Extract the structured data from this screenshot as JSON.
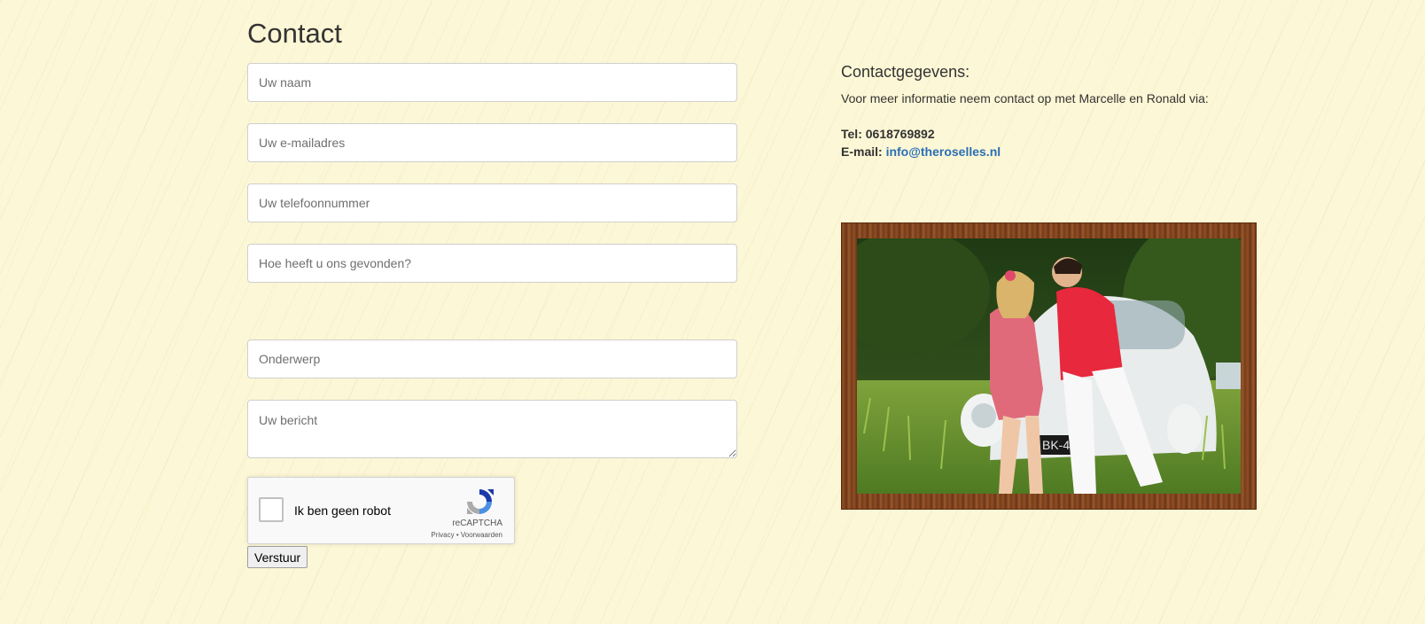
{
  "form": {
    "title": "Contact",
    "fields": {
      "name_placeholder": "Uw naam",
      "email_placeholder": "Uw e-mailadres",
      "phone_placeholder": "Uw telefoonnummer",
      "found_placeholder": "Hoe heeft u ons gevonden?",
      "subject_placeholder": "Onderwerp",
      "message_placeholder": "Uw bericht"
    },
    "recaptcha": {
      "label": "Ik ben geen robot",
      "brand": "reCAPTCHA",
      "privacy": "Privacy",
      "separator": " • ",
      "terms": "Voorwaarden"
    },
    "submit_label": "Verstuur"
  },
  "contact": {
    "heading": "Contactgegevens:",
    "intro": "Voor meer informatie neem contact op met Marcelle en Ronald via:",
    "tel_label": "Tel: ",
    "tel_value": "0618769892",
    "email_label": "E-mail: ",
    "email_value": "info@theroselles.nl",
    "photo_plate": "BK-45"
  },
  "colors": {
    "background": "#fcf7d6",
    "link": "#2a6fb6",
    "frame_wood": "#7a3f1c"
  }
}
